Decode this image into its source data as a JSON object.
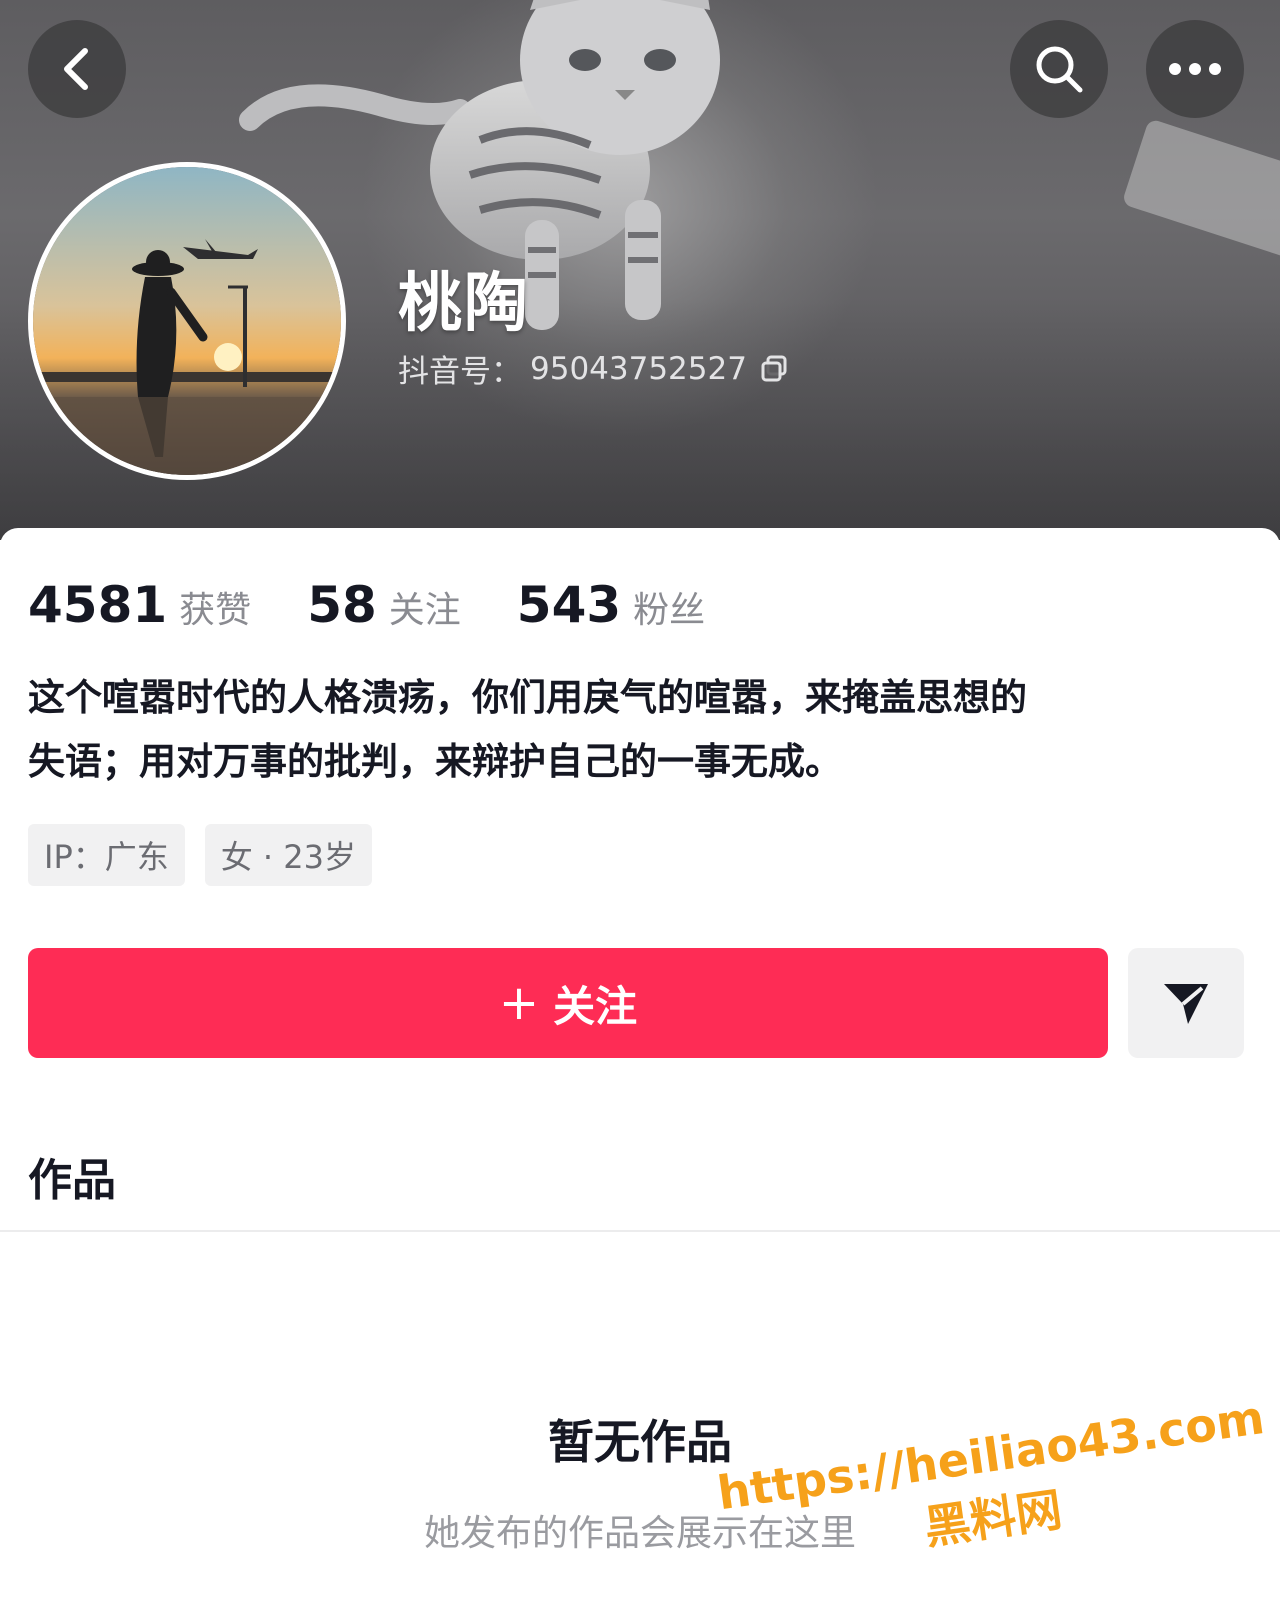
{
  "header": {
    "back_icon": "chevron-left-icon",
    "search_icon": "search-icon",
    "more_icon": "more-dots-icon"
  },
  "profile": {
    "nickname": "桃陶",
    "account_label": "抖音号：",
    "account_id": "95043752527",
    "stats": [
      {
        "value": "4581",
        "label": "获赞"
      },
      {
        "value": "58",
        "label": "关注"
      },
      {
        "value": "543",
        "label": "粉丝"
      }
    ],
    "bio_lines": [
      "这个喧嚣时代的人格溃疡，你们用戾气的喧嚣，来掩盖思想的",
      "失语；用对万事的批判，来辩护自己的一事无成。"
    ],
    "tags": [
      "IP：广东",
      "女 · 23岁"
    ]
  },
  "actions": {
    "follow_plus": "+",
    "follow_label": "关注",
    "share_icon": "send-icon"
  },
  "works": {
    "tab_label": "作品",
    "empty_title": "暂无作品",
    "empty_subtitle": "她发布的作品会展示在这里"
  },
  "watermark": {
    "url": "https://heiliao43.com",
    "name": "黑料网"
  },
  "colors": {
    "accent": "#fe2c55",
    "text_primary": "#161823",
    "text_secondary": "#8a8b91",
    "tag_bg": "#f1f1f2",
    "watermark": "#f6a11a"
  }
}
